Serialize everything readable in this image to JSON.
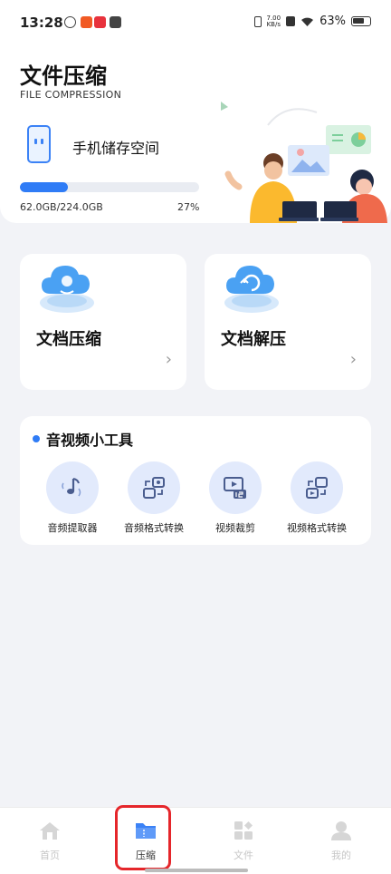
{
  "status_bar": {
    "time": "13:28",
    "net_speed_value": "7.00",
    "net_speed_unit": "KB/s",
    "battery": "63%"
  },
  "header": {
    "title": "文件压缩",
    "subtitle": "FILE COMPRESSION"
  },
  "storage": {
    "label": "手机储存空间",
    "used": "62.0GB/224.0GB",
    "percent_text": "27%",
    "percent_value": 27
  },
  "cards": [
    {
      "title": "文档压缩",
      "icon": "cloud-compress-icon"
    },
    {
      "title": "文档解压",
      "icon": "cloud-decompress-icon"
    }
  ],
  "tools": {
    "heading": "音视频小工具",
    "items": [
      {
        "label": "音频提取器",
        "icon": "audio-extract-icon"
      },
      {
        "label": "音频格式转换",
        "icon": "audio-convert-icon"
      },
      {
        "label": "视频裁剪",
        "icon": "video-trim-icon"
      },
      {
        "label": "视频格式转换",
        "icon": "video-convert-icon"
      }
    ]
  },
  "nav": {
    "items": [
      {
        "label": "首页",
        "icon": "home-icon",
        "active": false
      },
      {
        "label": "压缩",
        "icon": "folder-icon",
        "active": true
      },
      {
        "label": "文件",
        "icon": "files-icon",
        "active": false
      },
      {
        "label": "我的",
        "icon": "profile-icon",
        "active": false
      }
    ]
  },
  "colors": {
    "accent": "#2f7cf6",
    "highlight": "#e5262b",
    "background": "#f2f3f7"
  }
}
